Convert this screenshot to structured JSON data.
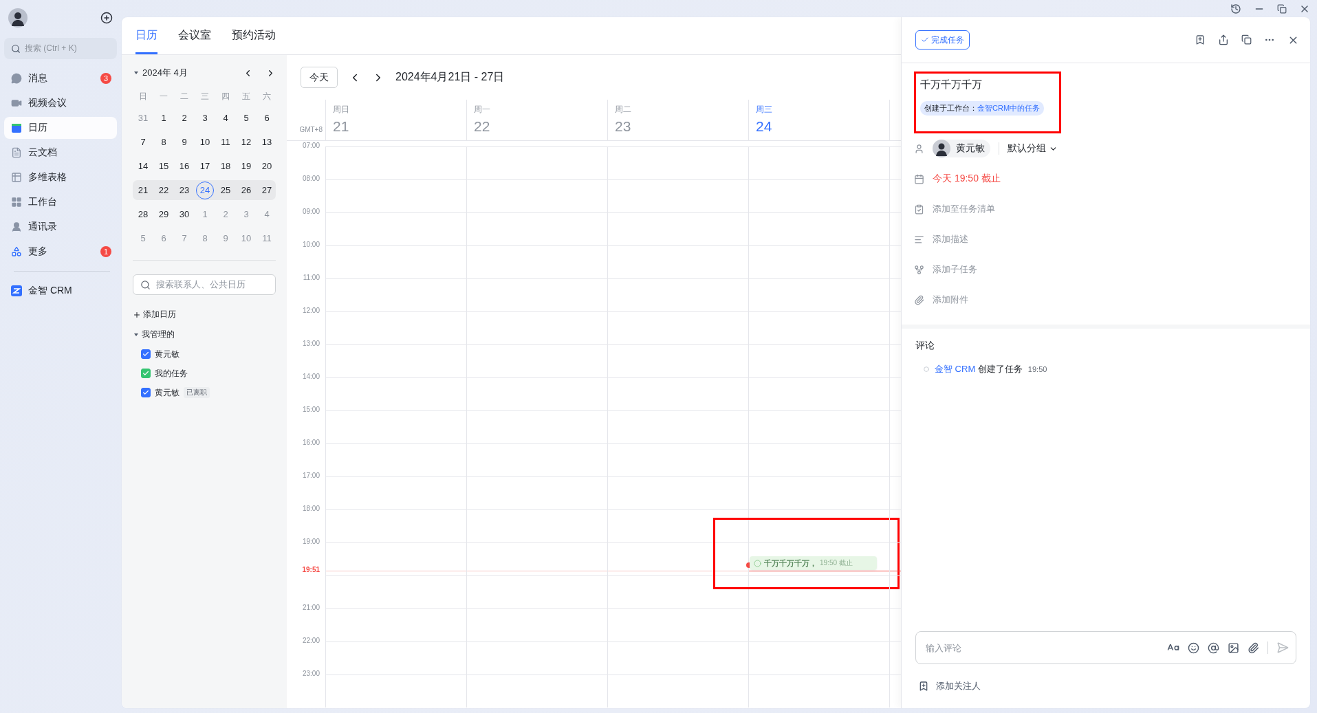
{
  "sidebar": {
    "search": {
      "placeholder": "搜索 (Ctrl + K)"
    },
    "items": [
      {
        "kind": "messages",
        "label": "消息",
        "selected": false,
        "badge": "3"
      },
      {
        "kind": "video",
        "label": "视频会议",
        "selected": false
      },
      {
        "kind": "calendar",
        "label": "日历",
        "selected": true
      },
      {
        "kind": "docs",
        "label": "云文档",
        "selected": false
      },
      {
        "kind": "sheets",
        "label": "多维表格",
        "selected": false
      },
      {
        "kind": "workplace",
        "label": "工作台",
        "selected": false
      },
      {
        "kind": "contacts",
        "label": "通讯录",
        "selected": false
      },
      {
        "kind": "more",
        "label": "更多",
        "selected": false,
        "badge": "1"
      }
    ],
    "apps": [
      {
        "kind": "crm",
        "label": "金智 CRM",
        "selected": false
      }
    ]
  },
  "tabs": [
    {
      "label": "日历",
      "selected": true
    },
    {
      "label": "会议室",
      "selected": false
    },
    {
      "label": "预约活动",
      "selected": false
    }
  ],
  "mini_calendar": {
    "title": "2024年 4月",
    "expanded": true,
    "weekdays": [
      "日",
      "一",
      "二",
      "三",
      "四",
      "五",
      "六"
    ],
    "weeks": [
      {
        "selected": false,
        "days": [
          {
            "label": "31",
            "muted": true,
            "today": false
          },
          {
            "label": "1",
            "muted": false,
            "today": false
          },
          {
            "label": "2",
            "muted": false,
            "today": false
          },
          {
            "label": "3",
            "muted": false,
            "today": false
          },
          {
            "label": "4",
            "muted": false,
            "today": false
          },
          {
            "label": "5",
            "muted": false,
            "today": false
          },
          {
            "label": "6",
            "muted": false,
            "today": false
          }
        ]
      },
      {
        "selected": false,
        "days": [
          {
            "label": "7",
            "muted": false,
            "today": false
          },
          {
            "label": "8",
            "muted": false,
            "today": false
          },
          {
            "label": "9",
            "muted": false,
            "today": false
          },
          {
            "label": "10",
            "muted": false,
            "today": false
          },
          {
            "label": "11",
            "muted": false,
            "today": false
          },
          {
            "label": "12",
            "muted": false,
            "today": false
          },
          {
            "label": "13",
            "muted": false,
            "today": false
          }
        ]
      },
      {
        "selected": false,
        "days": [
          {
            "label": "14",
            "muted": false,
            "today": false
          },
          {
            "label": "15",
            "muted": false,
            "today": false
          },
          {
            "label": "16",
            "muted": false,
            "today": false
          },
          {
            "label": "17",
            "muted": false,
            "today": false
          },
          {
            "label": "18",
            "muted": false,
            "today": false
          },
          {
            "label": "19",
            "muted": false,
            "today": false
          },
          {
            "label": "20",
            "muted": false,
            "today": false
          }
        ]
      },
      {
        "selected": true,
        "days": [
          {
            "label": "21",
            "muted": false,
            "today": false
          },
          {
            "label": "22",
            "muted": false,
            "today": false
          },
          {
            "label": "23",
            "muted": false,
            "today": false
          },
          {
            "label": "24",
            "muted": false,
            "today": true
          },
          {
            "label": "25",
            "muted": false,
            "today": false
          },
          {
            "label": "26",
            "muted": false,
            "today": false
          },
          {
            "label": "27",
            "muted": false,
            "today": false
          }
        ]
      },
      {
        "selected": false,
        "days": [
          {
            "label": "28",
            "muted": false,
            "today": false
          },
          {
            "label": "29",
            "muted": false,
            "today": false
          },
          {
            "label": "30",
            "muted": false,
            "today": false
          },
          {
            "label": "1",
            "muted": true,
            "today": false
          },
          {
            "label": "2",
            "muted": true,
            "today": false
          },
          {
            "label": "3",
            "muted": true,
            "today": false
          },
          {
            "label": "4",
            "muted": true,
            "today": false
          }
        ]
      },
      {
        "selected": false,
        "days": [
          {
            "label": "5",
            "muted": true,
            "today": false
          },
          {
            "label": "6",
            "muted": true,
            "today": false
          },
          {
            "label": "7",
            "muted": true,
            "today": false
          },
          {
            "label": "8",
            "muted": true,
            "today": false
          },
          {
            "label": "9",
            "muted": true,
            "today": false
          },
          {
            "label": "10",
            "muted": true,
            "today": false
          },
          {
            "label": "11",
            "muted": true,
            "today": false
          }
        ]
      }
    ]
  },
  "calendar_search": {
    "placeholder": "搜索联系人、公共日历"
  },
  "add_calendar": "添加日历",
  "calendar_groups": [
    {
      "label": "我管理的",
      "expanded": true,
      "items": [
        {
          "label": "黄元敏",
          "checked": true,
          "color": "#3370ff"
        },
        {
          "label": "我的任务",
          "checked": true,
          "color": "#34c471"
        },
        {
          "label": "黄元敏",
          "checked": true,
          "color": "#3370ff",
          "tag": "已离职"
        }
      ]
    }
  ],
  "week_view": {
    "today_button": "今天",
    "range": "2024年4月21日 - 27日",
    "timezone": "GMT+8",
    "days": [
      {
        "weekday": "周日",
        "date": "21",
        "selected": false
      },
      {
        "weekday": "周一",
        "date": "22",
        "selected": false
      },
      {
        "weekday": "周二",
        "date": "23",
        "selected": false
      },
      {
        "weekday": "周三",
        "date": "24",
        "selected": true,
        "events": [
          {
            "title": "千万千万千万，",
            "due": "19:50 截止",
            "done": false,
            "highlighted": true
          }
        ]
      }
    ],
    "hours": [
      {
        "kind": "hour",
        "label": "07:00"
      },
      {
        "kind": "hour",
        "label": "08:00"
      },
      {
        "kind": "hour",
        "label": "09:00"
      },
      {
        "kind": "hour",
        "label": "10:00"
      },
      {
        "kind": "hour",
        "label": "11:00"
      },
      {
        "kind": "hour",
        "label": "12:00"
      },
      {
        "kind": "hour",
        "label": "13:00"
      },
      {
        "kind": "hour",
        "label": "14:00"
      },
      {
        "kind": "hour",
        "label": "15:00"
      },
      {
        "kind": "hour",
        "label": "16:00"
      },
      {
        "kind": "hour",
        "label": "17:00"
      },
      {
        "kind": "hour",
        "label": "18:00"
      },
      {
        "kind": "hour",
        "label": "19:00"
      },
      {
        "kind": "now",
        "label": "19:51"
      },
      {
        "kind": "hour",
        "label": "21:00"
      },
      {
        "kind": "hour",
        "label": "22:00"
      },
      {
        "kind": "hour",
        "label": "23:00"
      }
    ]
  },
  "task": {
    "complete_button": "完成任务",
    "title": "千万千万千万",
    "highlighted": true,
    "source": {
      "prefix": "创建于工作台：",
      "link": "金智CRM中的任务"
    },
    "assignee": "黄元敏",
    "group": "默认分组",
    "due": {
      "text": "今天 19:50 截止",
      "overdue": true
    },
    "actions": [
      {
        "kind": "list",
        "label": "添加至任务清单"
      },
      {
        "kind": "description",
        "label": "添加描述"
      },
      {
        "kind": "subtask",
        "label": "添加子任务"
      },
      {
        "kind": "attachment",
        "label": "添加附件"
      }
    ],
    "comments": {
      "title": "评论",
      "entries": [
        {
          "actor": "金智 CRM",
          "action": "创建了任务",
          "time": "19:50"
        }
      ],
      "input": {
        "placeholder": "输入评论"
      },
      "follow": "添加关注人"
    }
  }
}
